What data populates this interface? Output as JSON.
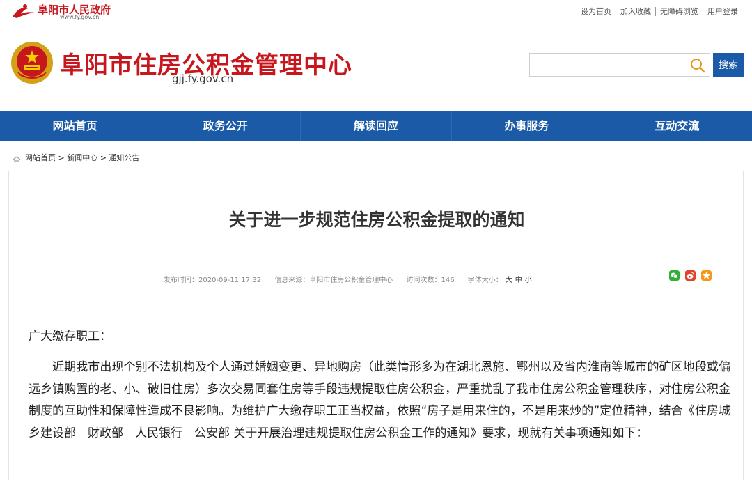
{
  "topbar": {
    "brand_name": "阜阳市人民政府",
    "brand_url": "www.fy.gov.cn",
    "links": [
      "设为首页",
      "加入收藏",
      "无障碍浏览",
      "用户登录"
    ]
  },
  "header": {
    "title": "阜阳市住房公积金管理中心",
    "url": "gjj.fy.gov.cn",
    "search_placeholder": "",
    "search_button": "搜索"
  },
  "nav": {
    "items": [
      "网站首页",
      "政务公开",
      "解读回应",
      "办事服务",
      "互动交流"
    ]
  },
  "breadcrumb": {
    "items": [
      "网站首页",
      "新闻中心",
      "通知公告"
    ],
    "separator": ">"
  },
  "article": {
    "title": "关于进一步规范住房公积金提取的通知",
    "meta": {
      "published": "发布时间：2020-09-11 17:32",
      "source": "信息来源：阜阳市住房公积金管理中心",
      "views": "访问次数：146",
      "font_size_label": "字体大小：",
      "font_size_options": [
        "大",
        "中",
        "小"
      ]
    },
    "share_icons": [
      "wechat-icon",
      "weibo-icon",
      "favorite-icon"
    ],
    "salutation": "广大缴存职工：",
    "paragraph": "近期我市出现个别不法机构及个人通过婚姻变更、异地购房（此类情形多为在湖北恩施、鄂州以及省内淮南等城市的矿区地段或偏远乡镇购置的老、小、破旧住房）多次交易同套住房等手段违规提取住房公积金，严重扰乱了我市住房公积金管理秩序，对住房公积金制度的互助性和保障性造成不良影响。为维护广大缴存职工正当权益，依照“房子是用来住的，不是用来炒的”定位精神，结合《住房城乡建设部　财政部　人民银行　公安部 关于开展治理违规提取住房公积金工作的通知》要求，现就有关事项通知如下："
  },
  "colors": {
    "brand_red": "#c8161d",
    "nav_blue": "#1b5aa6"
  }
}
